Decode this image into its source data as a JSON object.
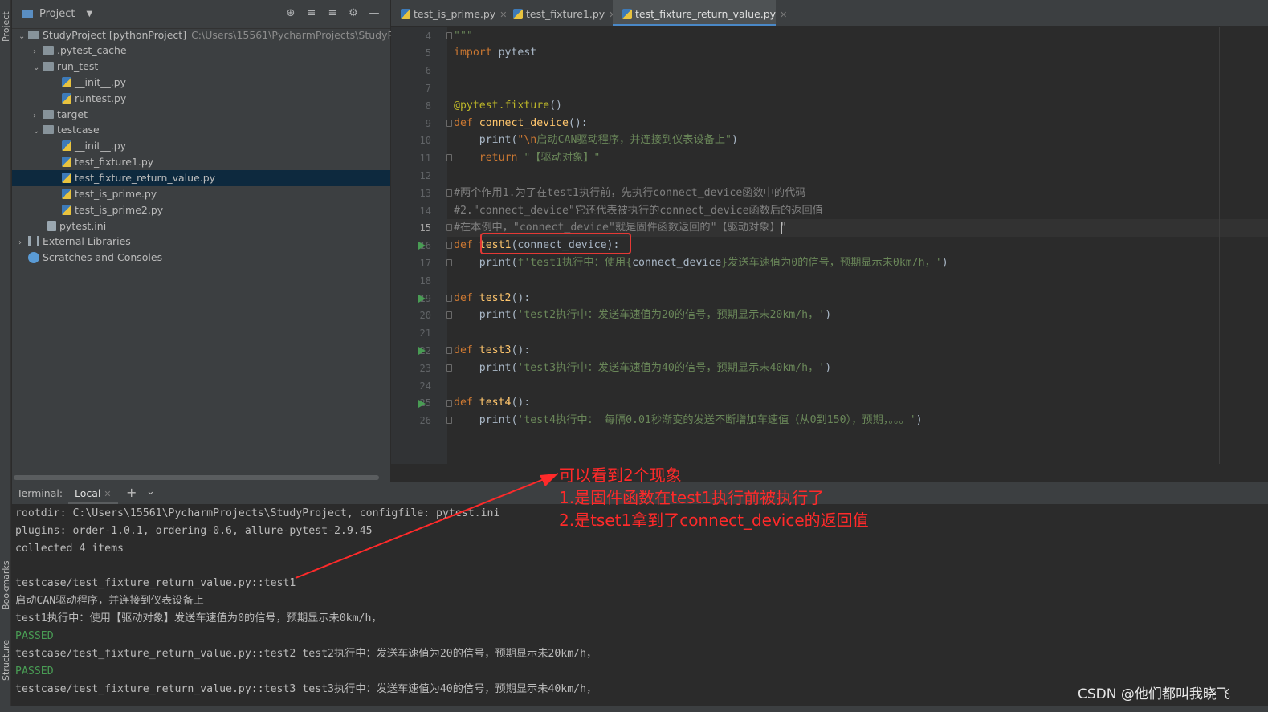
{
  "left_strip": {
    "project_label": "Project",
    "bookmarks_label": "Bookmarks",
    "structure_label": "Structure"
  },
  "project_panel": {
    "title": "Project",
    "root": {
      "label": "StudyProject [pythonProject]",
      "path": "C:\\Users\\15561\\PycharmProjects\\StudyProje"
    },
    "items": [
      {
        "label": ".pytest_cache"
      },
      {
        "label": "run_test"
      },
      {
        "label": "__init__.py"
      },
      {
        "label": "runtest.py"
      },
      {
        "label": "target"
      },
      {
        "label": "testcase"
      },
      {
        "label": "__init__.py"
      },
      {
        "label": "test_fixture1.py"
      },
      {
        "label": "test_fixture_return_value.py"
      },
      {
        "label": "test_is_prime.py"
      },
      {
        "label": "test_is_prime2.py"
      },
      {
        "label": "pytest.ini"
      },
      {
        "label": "External Libraries"
      },
      {
        "label": "Scratches and Consoles"
      }
    ],
    "selected_item": "test_fixture_return_value.py"
  },
  "editor": {
    "tabs": [
      {
        "label": "test_is_prime.py"
      },
      {
        "label": "test_fixture1.py"
      },
      {
        "label": "test_fixture_return_value.py"
      }
    ],
    "active_tab": "test_fixture_return_value.py",
    "current_line": "15",
    "lines": [
      {
        "n": "4",
        "t": "\"\"\""
      },
      {
        "n": "5",
        "kw1": "import",
        "t": " pytest"
      },
      {
        "n": "6",
        "t": ""
      },
      {
        "n": "7",
        "t": ""
      },
      {
        "n": "8",
        "t": "@pytest.fixture",
        "t2": "()"
      },
      {
        "n": "9",
        "kw1": "def",
        "fn": " connect_device",
        "t": "():"
      },
      {
        "n": "10",
        "pre": "    print(",
        "esc": "\"\\n",
        "str": "启动CAN驱动程序，并连接到仪表设备上\"",
        "post": ")"
      },
      {
        "n": "11",
        "kw1": "    return",
        "str": " \"【驱动对象】\""
      },
      {
        "n": "12",
        "t": ""
      },
      {
        "n": "13",
        "t": "#两个作用1.为了在test1执行前，先执行connect_device函数中的代码"
      },
      {
        "n": "14",
        "t": "#2.\"connect_device\"它还代表被执行的connect_device函数后的返回值"
      },
      {
        "n": "15",
        "t": "#在本例中，\"connect_device\"就是固件函数返回的\"【驱动对象】\""
      },
      {
        "n": "16",
        "kw1": "def",
        "fn": " test1",
        "t": "(connect_device):"
      },
      {
        "n": "17",
        "pre": "    print(",
        "str": "f'test1执行中：使用{",
        "mid": "connect_device",
        "str2": "}发送车速值为0的信号，预期显示未0km/h，'",
        "post": ")"
      },
      {
        "n": "18",
        "t": ""
      },
      {
        "n": "19",
        "kw1": "def",
        "fn": " test2",
        "t": "():"
      },
      {
        "n": "20",
        "pre": "    print(",
        "str": "'test2执行中：发送车速值为20的信号，预期显示未20km/h，'",
        "post": ")"
      },
      {
        "n": "21",
        "t": ""
      },
      {
        "n": "22",
        "kw1": "def",
        "fn": " test3",
        "t": "():"
      },
      {
        "n": "23",
        "pre": "    print(",
        "str": "'test3执行中：发送车速值为40的信号，预期显示未40km/h，'",
        "post": ")"
      },
      {
        "n": "24",
        "t": ""
      },
      {
        "n": "25",
        "kw1": "def",
        "fn": " test4",
        "t": "():"
      },
      {
        "n": "26",
        "pre": "    print(",
        "str": "'test4执行中： 每隔0.01秒渐变的发送不断增加车速值（从0到150），预期，。。。'",
        "post": ")"
      }
    ]
  },
  "terminal": {
    "label": "Terminal:",
    "tab": "Local",
    "lines": [
      "rootdir: C:\\Users\\15561\\PycharmProjects\\StudyProject, configfile: pytest.ini",
      "plugins: order-1.0.1, ordering-0.6, allure-pytest-2.9.45",
      "collected 4 items",
      "",
      "testcase/test_fixture_return_value.py::test1",
      "启动CAN驱动程序，并连接到仪表设备上",
      "test1执行中：使用【驱动对象】发送车速值为0的信号，预期显示未0km/h，",
      "PASSED",
      "testcase/test_fixture_return_value.py::test2 test2执行中：发送车速值为20的信号，预期显示未20km/h，",
      "PASSED",
      "testcase/test_fixture_return_value.py::test3 test3执行中：发送车速值为40的信号，预期显示未40km/h，"
    ]
  },
  "annotation": {
    "line1": "可以看到2个现象",
    "line2": "1.是固件函数在test1执行前被执行了",
    "line3": "2.是tset1拿到了connect_device的返回值",
    "color": "#ff2a2a"
  },
  "watermark": "CSDN @他们都叫我晓飞",
  "colors": {
    "keyword": "#cc7832",
    "function": "#ffc66d",
    "string": "#6a8759",
    "comment": "#808080",
    "passed": "#499c54",
    "selection": "#0d293e",
    "tab_underline": "#4a88c7"
  }
}
